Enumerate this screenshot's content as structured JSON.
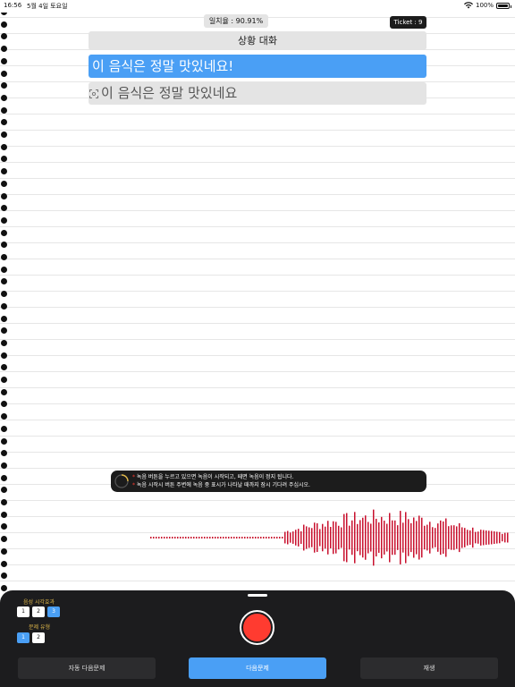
{
  "status_bar": {
    "time": "16:56",
    "date": "5월 4일 토요일",
    "battery": "100%",
    "wifi_icon": "wifi-icon",
    "battery_icon": "battery-icon"
  },
  "header": {
    "match_rate": "일치율 : 90.91%",
    "ticket": "Ticket : 9",
    "title": "상황 대화"
  },
  "sentence": {
    "target": "이 음식은 정말 맛있네요!",
    "recognized": "이 음식은 정말 맛있네요",
    "recognized_icon": "scan-icon"
  },
  "hint": {
    "line1": "녹음 버튼을 누르고 있으면 녹음이 시작되고, 떼면 녹음이 정지 됩니다.",
    "line2": "녹음 시작시 버튼 주변에 녹음 중 표시가 나타날 때까지 잠시 기다려 주십시오.",
    "bullet": "*"
  },
  "panel": {
    "sound_effect_label": "음성 시각효과",
    "sound_effect_options": [
      "1",
      "2",
      "3"
    ],
    "sound_effect_selected": 3,
    "question_type_label": "문제 유형",
    "question_type_options": [
      "1",
      "2"
    ],
    "question_type_selected": 1,
    "auto_next_label": "자동 다음문제",
    "next_label": "다음문제",
    "play_label": "재생"
  },
  "colors": {
    "accent": "#4a9ff5",
    "record": "#ff3b30",
    "waveform": "#c8102e",
    "panel_bg": "#1c1c1e",
    "label_gold": "#e0b84a"
  }
}
